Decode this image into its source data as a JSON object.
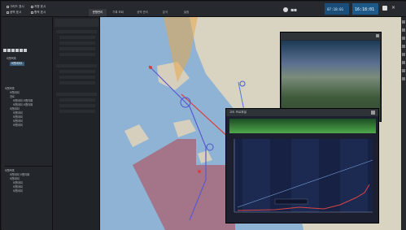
{
  "topbar": {
    "tabs": [
      {
        "label": "운항관리"
      },
      {
        "label": "기록 조회"
      },
      {
        "label": "공역 관리"
      },
      {
        "label": "분석"
      },
      {
        "label": "설정"
      }
    ],
    "right": {
      "clock1": "07:18:01",
      "clock2": "16:18:01"
    }
  },
  "sidebar": {
    "section1": "비행목록",
    "item1": "비행계획1",
    "tree_a": [
      "비행목록",
      "비행계획",
      "경로",
      "비행계획 비행계획",
      "비행계획 비행계획",
      "비행계획",
      "비행계획",
      "비행계획",
      "비행계획",
      "비행계획"
    ],
    "tree_b": [
      "비행목록",
      "비행계획 비행계획",
      "비행계획",
      "비행계획",
      "비행계획",
      "비행계획"
    ]
  },
  "panel": {
    "title": "고도 프로파일"
  }
}
